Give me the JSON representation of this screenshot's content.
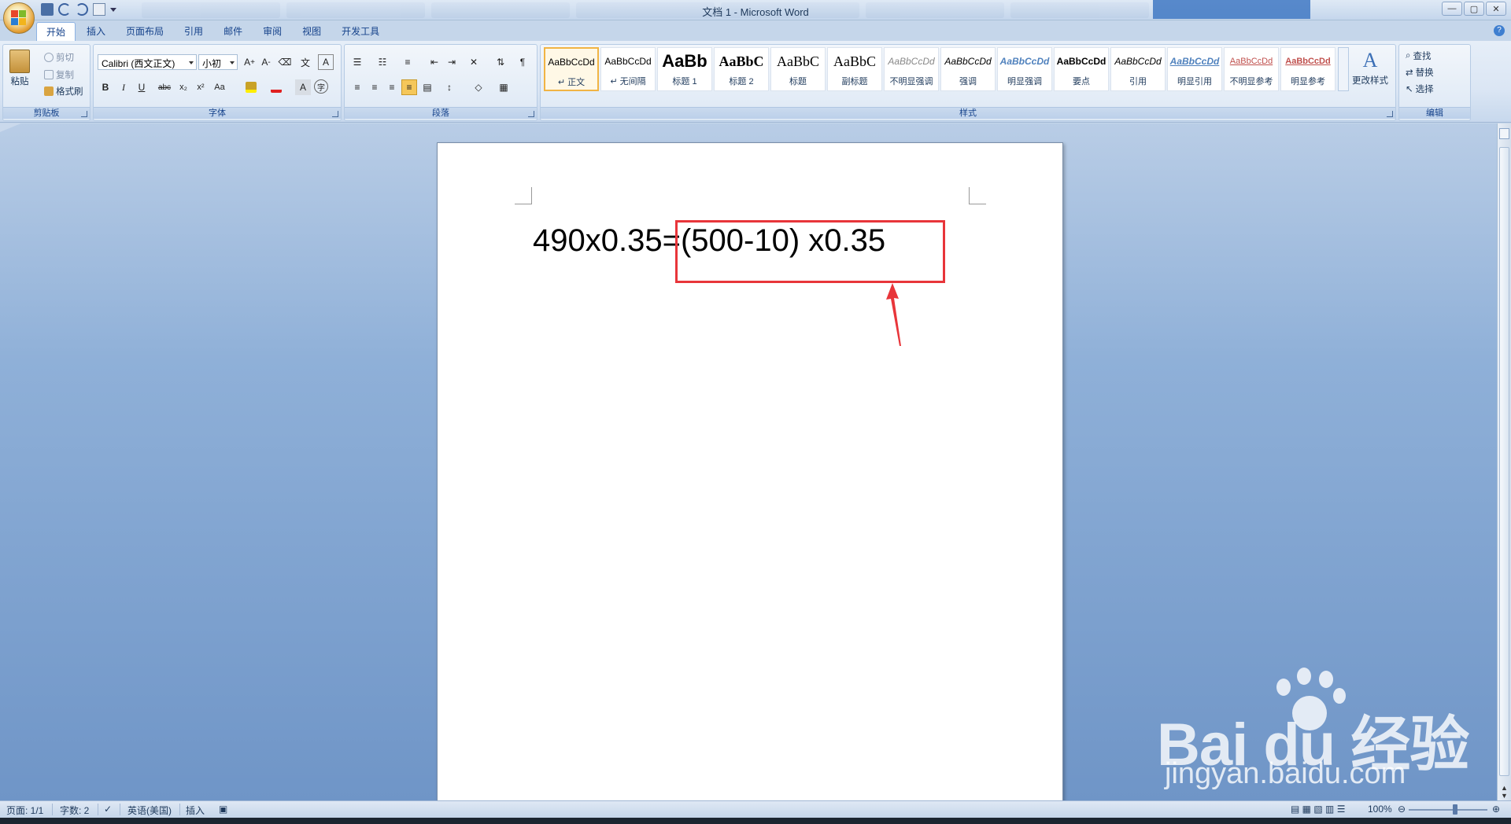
{
  "window": {
    "title": "文档 1 - Microsoft Word",
    "controls": [
      "—",
      "▢",
      "✕"
    ]
  },
  "tabs": [
    "开始",
    "插入",
    "页面布局",
    "引用",
    "邮件",
    "审阅",
    "视图",
    "开发工具"
  ],
  "clipboard": {
    "paste": "粘贴",
    "cut": "剪切",
    "copy": "复制",
    "format_painter": "格式刷",
    "label": "剪贴板"
  },
  "font": {
    "name": "Calibri (西文正文)",
    "size": "小初",
    "label": "字体",
    "buttons": [
      "B",
      "I",
      "U",
      "abc",
      "x₂",
      "x²",
      "Aa"
    ]
  },
  "paragraph": {
    "label": "段落"
  },
  "styles": {
    "label": "样式",
    "items": [
      {
        "sample": "AaBbCcDd",
        "name": "↵ 正文"
      },
      {
        "sample": "AaBbCcDd",
        "name": "↵ 无间隔"
      },
      {
        "sample": "AaBb",
        "name": "标题 1"
      },
      {
        "sample": "AaBbC",
        "name": "标题 2"
      },
      {
        "sample": "AaBbC",
        "name": "标题"
      },
      {
        "sample": "AaBbC",
        "name": "副标题"
      },
      {
        "sample": "AaBbCcDd",
        "name": "不明显强调"
      },
      {
        "sample": "AaBbCcDd",
        "name": "强调"
      },
      {
        "sample": "AaBbCcDd",
        "name": "明显强调"
      },
      {
        "sample": "AaBbCcDd",
        "name": "要点"
      },
      {
        "sample": "AaBbCcDd",
        "name": "引用"
      },
      {
        "sample": "AaBbCcDd",
        "name": "明显引用"
      },
      {
        "sample": "AaBbCcDd",
        "name": "不明显参考"
      },
      {
        "sample": "AaBbCcDd",
        "name": "明显参考"
      }
    ],
    "change_styles": "更改样式"
  },
  "editing": {
    "label": "编辑",
    "find": "查找",
    "replace": "替换",
    "select": "选择"
  },
  "document": {
    "text": "490x0.35=(500-10) x0.35"
  },
  "statusbar": {
    "page": "页面: 1/1",
    "words": "字数: 2",
    "language": "英语(美国)",
    "mode": "插入",
    "zoom": "100%"
  },
  "watermark": {
    "brand": "Bai du 经验",
    "url": "jingyan.baidu.com"
  },
  "colors": {
    "highlight_box": "#e8353a",
    "accent": "#15428b"
  }
}
